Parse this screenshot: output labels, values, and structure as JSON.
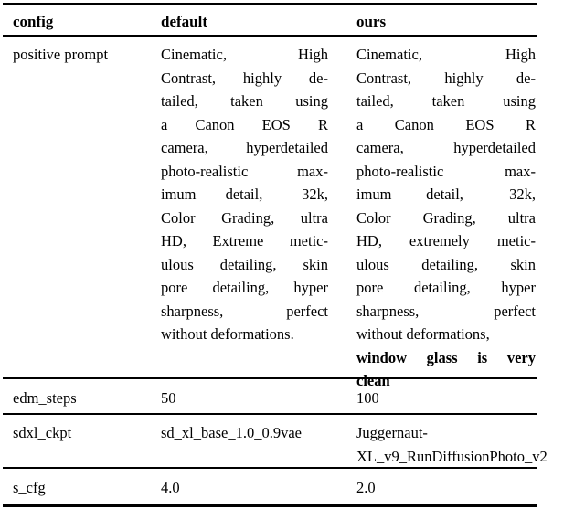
{
  "table": {
    "columns": [
      "config",
      "default",
      "ours"
    ],
    "rows": [
      {
        "config": "positive prompt",
        "default_lines": [
          "Cinematic,        High",
          "Contrast,  highly  de-",
          "tailed,   taken   using",
          "a    Canon    EOS    R",
          "camera, hyperdetailed",
          "photo-realistic   max-",
          "imum   detail,    32k,",
          "Color  Grading,  ultra",
          "HD,  Extreme  metic-",
          "ulous  detailing,  skin",
          "pore  detailing,  hyper",
          "sharpness,     perfect",
          "without deformations."
        ],
        "default_text": "Cinematic, High Contrast, highly detailed, taken using a Canon EOS R camera, hyperdetailed photo-realistic maximum detail, 32k, Color Grading, ultra HD, Extreme meticulous detailing, skin pore detailing, hyper sharpness, perfect without deformations.",
        "ours_lines": [
          "Cinematic,        High",
          "Contrast,  highly  de-",
          "tailed,   taken   using",
          "a    Canon    EOS    R",
          "camera, hyperdetailed",
          "photo-realistic   max-",
          "imum   detail,    32k,",
          "Color  Grading,  ultra",
          "HD, extremely metic-",
          "ulous  detailing,  skin",
          "pore  detailing,  hyper",
          "sharpness,     perfect",
          "without deformations,"
        ],
        "ours_bold_lines": [
          "window glass is very",
          "clean"
        ],
        "ours_text": "Cinematic, High Contrast, highly detailed, taken using a Canon EOS R camera, hyperdetailed photo-realistic maximum detail, 32k, Color Grading, ultra HD, extremely meticulous detailing, skin pore detailing, hyper sharpness, perfect without deformations, window glass is very clean"
      },
      {
        "config": "edm_steps",
        "default": "50",
        "ours": "100"
      },
      {
        "config": "sdxl_ckpt",
        "default": "sd_xl_base_1.0_0.9vae",
        "ours_line1": "Juggernaut-",
        "ours_line2": "XL_v9_RunDiffusionPhoto_v2",
        "ours": "Juggernaut-XL_v9_RunDiffusionPhoto_v2"
      },
      {
        "config": "s_cfg",
        "default": "4.0",
        "ours": "2.0"
      }
    ]
  }
}
